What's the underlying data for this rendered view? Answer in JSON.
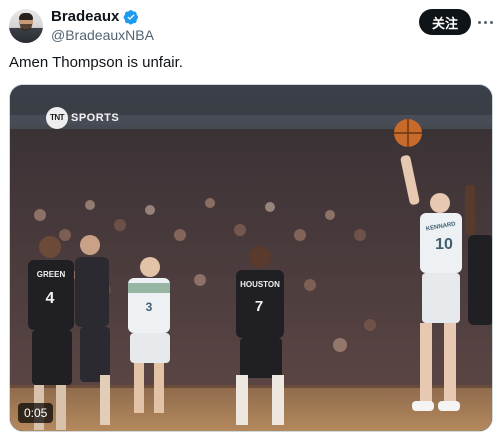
{
  "author": {
    "display_name": "Bradeaux",
    "handle": "@BradeauxNBA",
    "avatar_icon": "profile-avatar",
    "verified_icon": "verified-badge-icon",
    "verified_color": "#1d9bf0"
  },
  "actions": {
    "follow_label": "关注",
    "more_icon": "more-dots-icon"
  },
  "tweet": {
    "text": "Amen Thompson is unfair."
  },
  "media": {
    "type": "video",
    "timestamp": "0:05",
    "network_badge": "TNT",
    "network_word": "SPORTS",
    "players": [
      {
        "team": "houston",
        "jersey_name": "GREEN",
        "number": "4"
      },
      {
        "team": "houston",
        "jersey_name": "HOUSTON",
        "number": "7"
      },
      {
        "team": "memphis",
        "jersey_name": "",
        "number": "3"
      },
      {
        "team": "memphis",
        "jersey_name": "KENNARD",
        "number": "10"
      }
    ]
  },
  "colors": {
    "text_primary": "#0f1419",
    "text_secondary": "#536471",
    "follow_bg": "#0f1419",
    "houston_red": "#1f1f24",
    "memphis_white": "#eef1f3"
  }
}
